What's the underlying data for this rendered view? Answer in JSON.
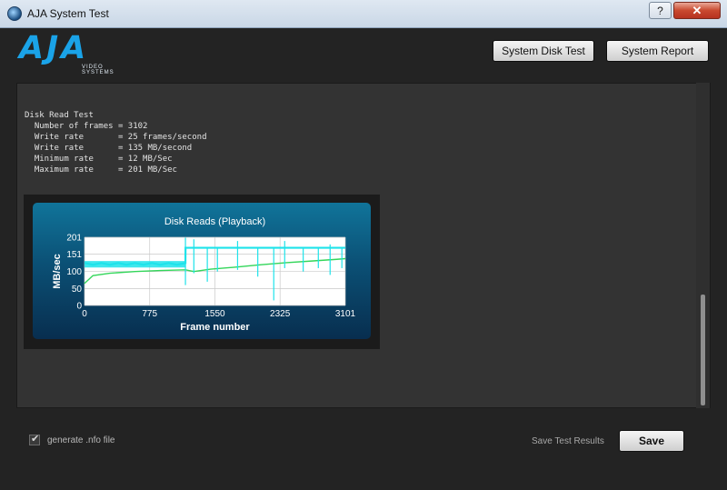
{
  "window": {
    "title": "AJA System Test",
    "help_label": "?",
    "close_label": "✕"
  },
  "logo": {
    "brand": "AJA",
    "sub": "VIDEO SYSTEMS"
  },
  "header": {
    "disk_test_label": "System Disk Test",
    "report_label": "System Report"
  },
  "results": {
    "heading": "Disk Read Test",
    "lines": [
      "  Number of frames = 3102",
      "  Write rate       = 25 frames/second",
      "  Write rate       = 135 MB/second",
      "  Minimum rate     = 12 MB/Sec",
      "  Maximum rate     = 201 MB/Sec"
    ]
  },
  "chart_data": {
    "type": "line",
    "title": "Disk Reads (Playback)",
    "xlabel": "Frame number",
    "ylabel": "MB/sec",
    "xlim": [
      0,
      3101
    ],
    "ylim": [
      0,
      201
    ],
    "xticks": [
      0,
      775,
      1550,
      2325,
      3101
    ],
    "yticks": [
      0,
      50,
      100,
      151,
      201
    ],
    "grid": true,
    "series": [
      {
        "color": "#1ee3ea",
        "x": [
          0,
          100,
          200,
          300,
          400,
          500,
          600,
          700,
          800,
          900,
          1000,
          1100,
          1200,
          1201,
          1300,
          1400,
          1500,
          1600,
          1700,
          1800,
          1900,
          2000,
          2100,
          2200,
          2300,
          2400,
          2500,
          2600,
          2700,
          2800,
          2900,
          3000,
          3101
        ],
        "values": [
          125,
          120,
          125,
          120,
          125,
          120,
          125,
          120,
          125,
          120,
          125,
          120,
          125,
          170,
          170,
          170,
          170,
          170,
          170,
          170,
          170,
          170,
          170,
          170,
          170,
          170,
          170,
          170,
          170,
          170,
          170,
          170,
          170
        ]
      },
      {
        "color": "#33d65a",
        "x": [
          0,
          100,
          300,
          600,
          900,
          1200,
          1300,
          1500,
          1800,
          2100,
          2400,
          2700,
          3000,
          3101
        ],
        "values": [
          65,
          88,
          95,
          100,
          103,
          105,
          100,
          107,
          113,
          120,
          126,
          131,
          136,
          138
        ]
      }
    ],
    "spikes": [
      {
        "x": 1200,
        "low": 60,
        "high": 200
      },
      {
        "x": 1300,
        "low": 95,
        "high": 195
      },
      {
        "x": 1460,
        "low": 70,
        "high": 170
      },
      {
        "x": 1580,
        "low": 100,
        "high": 170
      },
      {
        "x": 1820,
        "low": 105,
        "high": 190
      },
      {
        "x": 2060,
        "low": 85,
        "high": 170
      },
      {
        "x": 2250,
        "low": 15,
        "high": 170
      },
      {
        "x": 2380,
        "low": 110,
        "high": 190
      },
      {
        "x": 2600,
        "low": 100,
        "high": 170
      },
      {
        "x": 2780,
        "low": 110,
        "high": 170
      },
      {
        "x": 2920,
        "low": 90,
        "high": 180
      },
      {
        "x": 3060,
        "low": 110,
        "high": 170
      }
    ]
  },
  "footer": {
    "checkbox_label": "generate .nfo file",
    "checkbox_checked": true,
    "check_glyph": "✔",
    "save_results_label": "Save Test Results",
    "save_button_label": "Save"
  }
}
